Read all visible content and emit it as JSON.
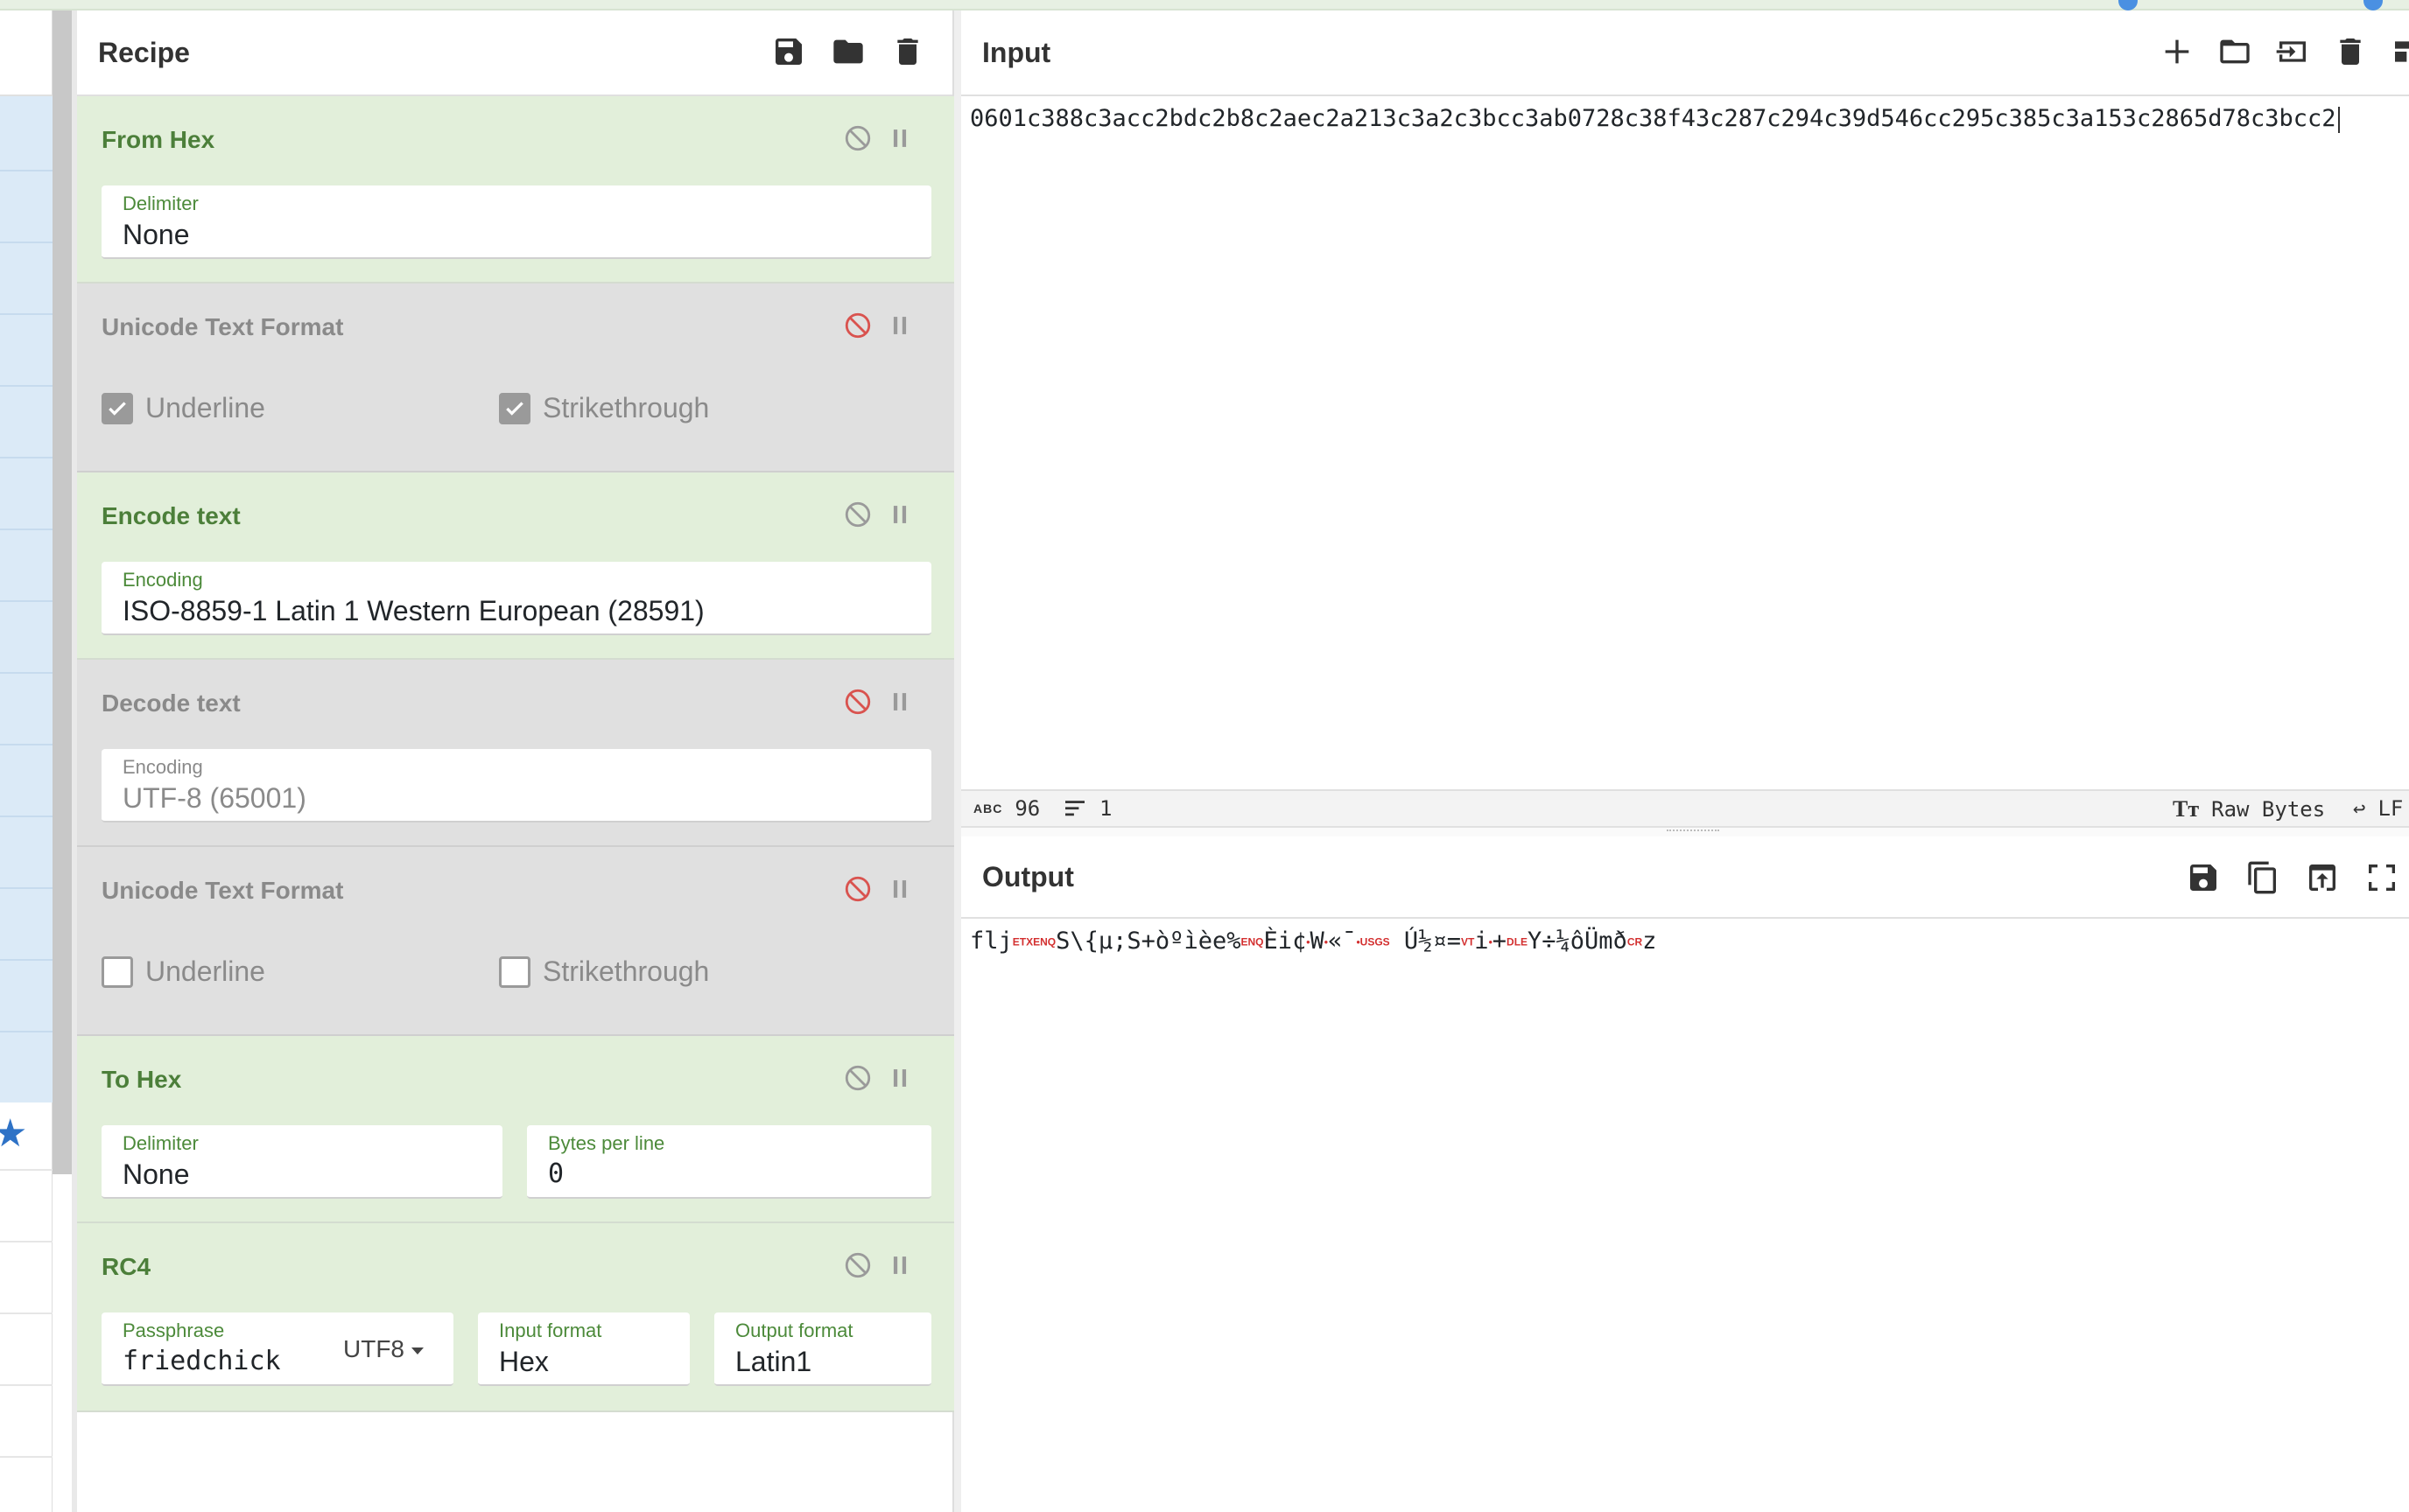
{
  "recipe": {
    "title": "Recipe",
    "ops": [
      {
        "name": "From Hex",
        "state": "enabled",
        "fields": [
          {
            "label": "Delimiter",
            "value": "None"
          }
        ]
      },
      {
        "name": "Unicode Text Format",
        "state": "disabled",
        "checks": [
          {
            "label": "Underline",
            "checked": true
          },
          {
            "label": "Strikethrough",
            "checked": true
          }
        ]
      },
      {
        "name": "Encode text",
        "state": "enabled",
        "fields": [
          {
            "label": "Encoding",
            "value": "ISO-8859-1 Latin 1 Western European (28591)"
          }
        ]
      },
      {
        "name": "Decode text",
        "state": "disabled",
        "fields": [
          {
            "label": "Encoding",
            "value": "UTF-8 (65001)"
          }
        ]
      },
      {
        "name": "Unicode Text Format",
        "state": "disabled",
        "checks": [
          {
            "label": "Underline",
            "checked": false
          },
          {
            "label": "Strikethrough",
            "checked": false
          }
        ]
      },
      {
        "name": "To Hex",
        "state": "enabled",
        "fields": [
          {
            "label": "Delimiter",
            "value": "None"
          },
          {
            "label": "Bytes per line",
            "value": "0"
          }
        ]
      },
      {
        "name": "RC4",
        "state": "enabled",
        "fields": [
          {
            "label": "Passphrase",
            "value": "friedchick",
            "suffix": "UTF8"
          },
          {
            "label": "Input format",
            "value": "Hex"
          },
          {
            "label": "Output format",
            "value": "Latin1"
          }
        ]
      }
    ]
  },
  "input": {
    "title": "Input",
    "value": "0601c388c3acc2bdc2b8c2aec2a213c3a2c3bcc3ab0728c38f43c287c294c39d546cc295c385c3a153c2865d78c3bcc2",
    "status": {
      "length": "96",
      "lines": "1",
      "encoding": "Raw Bytes",
      "eol": "LF"
    }
  },
  "output": {
    "title": "Output",
    "segments": [
      {
        "t": "flj"
      },
      {
        "c": "ETX"
      },
      {
        "c": "ENQ"
      },
      {
        "t": "S\\{µ;S+òºìèe%"
      },
      {
        "c": "ENQ"
      },
      {
        "t": "Èi¢"
      },
      {
        "c": "•"
      },
      {
        "t": "W"
      },
      {
        "c": "•"
      },
      {
        "t": "«¯"
      },
      {
        "c": "•"
      },
      {
        "c": "US"
      },
      {
        "c": "GS"
      },
      {
        "t": " Ú½¤="
      },
      {
        "c": "VT"
      },
      {
        "t": "i"
      },
      {
        "c": "•"
      },
      {
        "t": "+"
      },
      {
        "c": "DLE"
      },
      {
        "t": "Y÷¼ôÜmð"
      },
      {
        "c": "CR"
      },
      {
        "t": "z"
      }
    ]
  },
  "icons": {
    "recipe_header": [
      "save-icon",
      "folder-icon",
      "trash-icon"
    ],
    "input_header": [
      "plus-icon",
      "folder-icon",
      "import-icon",
      "trash-icon",
      "layout-icon"
    ],
    "output_header": [
      "save-icon",
      "copy-icon",
      "replace-input-icon",
      "fullscreen-icon"
    ]
  },
  "colors": {
    "enabled_bg": "#e2efda",
    "disabled_bg": "#e0e0e0",
    "enabled_title": "#4c7f3a",
    "disable_icon_active": "#d9534f"
  }
}
